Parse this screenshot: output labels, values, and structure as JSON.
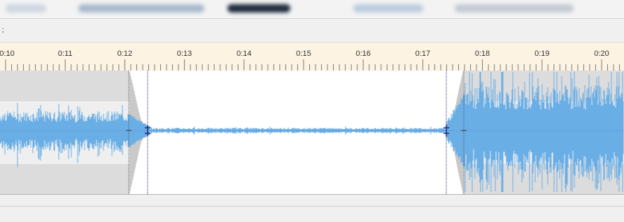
{
  "toolbar": {
    "glyph": ";"
  },
  "ruler": {
    "labels": [
      "0:10",
      "0:11",
      "0:12",
      "0:13",
      "0:14",
      "0:15",
      "0:16",
      "0:17",
      "0:18",
      "0:19",
      "0:20"
    ]
  },
  "colors": {
    "ruler_bg": "#fcf3e2",
    "waveform": "#6aaee6",
    "selection_bg": "#ffffff",
    "unselected_bg": "#dcdcdc",
    "fade_envelope": "#c9c9c9",
    "marker_line": "#1f2a80"
  },
  "icons": [
    "fade-in-handle-icon",
    "fade-out-handle-icon"
  ]
}
